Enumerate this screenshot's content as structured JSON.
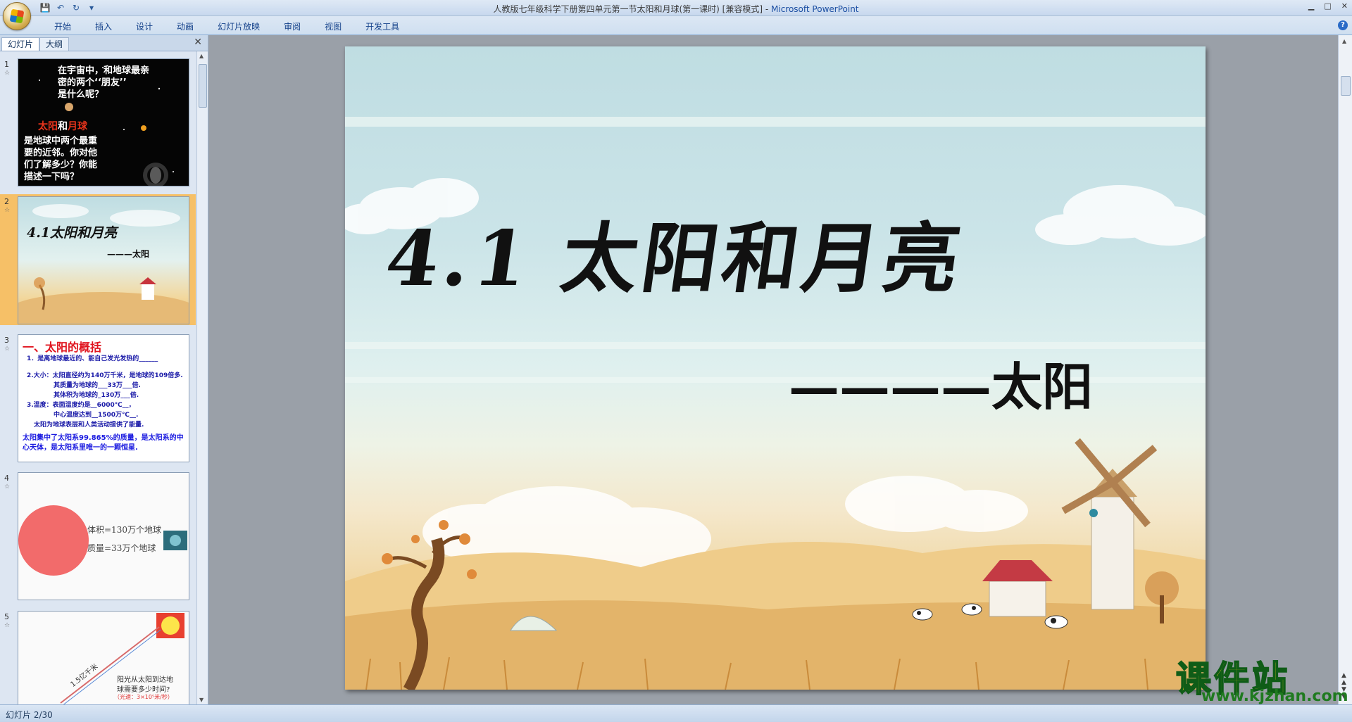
{
  "window": {
    "title": "人教版七年级科学下册第四单元第一节太阳和月球(第一课时) [兼容模式]",
    "separator": " - ",
    "app_name": "Microsoft PowerPoint",
    "minimize": "▁",
    "maximize": "□",
    "close": "✕"
  },
  "qat": {
    "save_icon": "💾",
    "undo_icon": "↶",
    "redo_icon": "↻",
    "more_icon": "▾"
  },
  "ribbon": {
    "tabs": [
      "开始",
      "插入",
      "设计",
      "动画",
      "幻灯片放映",
      "审阅",
      "视图",
      "开发工具"
    ],
    "help": "?"
  },
  "pane": {
    "tab_slides": "幻灯片",
    "tab_outline": "大纲",
    "close": "✕"
  },
  "thumbnails": [
    {
      "number": "1",
      "star": "☆",
      "lines": [
        "在宇宙中，和地球最亲",
        "密的两个‘‘朋友’’",
        "是什么呢？"
      ],
      "highlight_a": "太阳",
      "highlight_and": "和",
      "highlight_b": "月球",
      "lines2": [
        "是地球中两个最重",
        "要的近邻。你对他",
        "们了解多少？你能",
        "描述一下吗？"
      ]
    },
    {
      "number": "2",
      "star": "☆",
      "title": "4.1太阳和月亮",
      "sub": "———太阳"
    },
    {
      "number": "3",
      "star": "☆",
      "heading": "一、太阳的概括",
      "lines": [
        "1．是离地球最近的、能自己发光发热的______",
        "2.大小：太阳直径约为140万千米，是地球的109倍多.",
        "其质量为地球的___33万___倍.",
        "其体积为地球的_130万___倍.",
        "3.温度：表面温度约是__6000℃__，",
        "中心温度达到__1500万℃__.",
        "太阳为地球表层和人类活动提供了能量."
      ],
      "footer": "太阳集中了太阳系99.865%的质量，是太阳系的中心天体，是太阳系里唯一的一颗恒星."
    },
    {
      "number": "4",
      "star": "☆",
      "line1": "体积=130万个地球",
      "line2": "质量=33万个地球"
    },
    {
      "number": "5",
      "star": "☆",
      "diag": "1.5亿千米",
      "q1": "阳光从太阳到达地",
      "q2": "球需要多少时间?",
      "q3": "（光速：3×10⁵米/秒）"
    }
  ],
  "slide": {
    "title": "4.1 太阳和月亮",
    "subtitle": "————太阳"
  },
  "status": {
    "text": "幻灯片 2/30"
  },
  "watermark": {
    "line1": "课件站",
    "line2": "www.kjzhan.com"
  },
  "colors": {
    "accent_red": "#e8341c",
    "selection": "#f6c067",
    "title_text": "#111111"
  }
}
